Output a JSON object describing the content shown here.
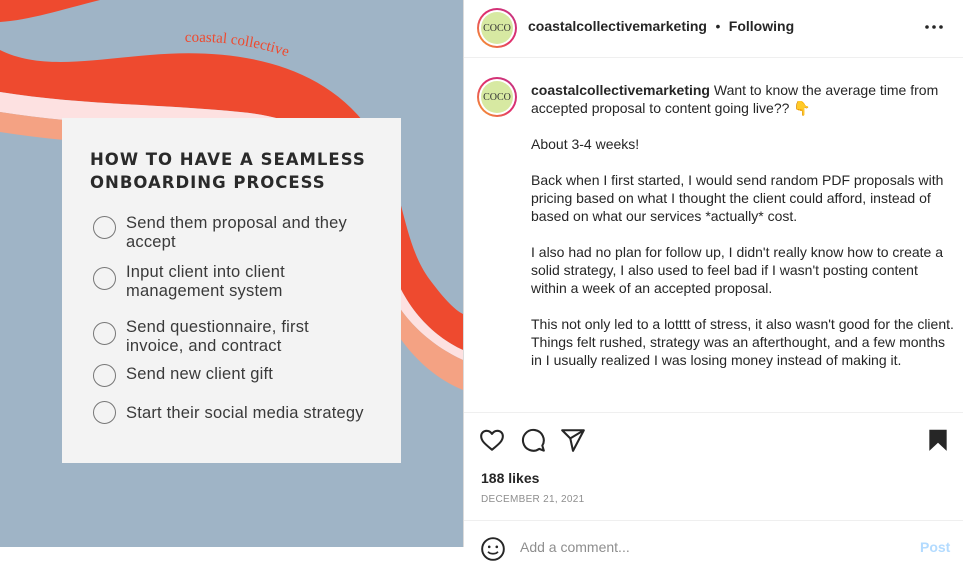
{
  "post_image": {
    "brand_arc_text": "coastal collective",
    "card_title_line1": "HOW TO HAVE A SEAMLESS",
    "card_title_line2": "ONBOARDING PROCESS",
    "checklist": [
      {
        "line1": "Send them proposal and they",
        "line2": "accept"
      },
      {
        "line1": "Input client into client",
        "line2": "management system"
      },
      {
        "line1": "Send questionnaire, first",
        "line2": "invoice, and contract"
      },
      {
        "line1": "Send new client gift",
        "line2": ""
      },
      {
        "line1": "Start their social media strategy",
        "line2": ""
      }
    ],
    "colors": {
      "background": "#9fb4c6",
      "wave_red": "#ee4a2f",
      "wave_pink": "#fde1e1",
      "wave_peach": "#f4a283",
      "card": "#f3f3f3"
    }
  },
  "header": {
    "avatar_text": "COCO",
    "username": "coastalcollectivemarketing",
    "separator": "•",
    "follow_status": "Following",
    "more_icon": "more-horizontal-icon"
  },
  "caption": {
    "avatar_text": "COCO",
    "username": "coastalcollectivemarketing",
    "intro": "Want to know the average time from accepted proposal to content going live?? 👇",
    "paragraphs": [
      "About 3-4 weeks!",
      "Back when I first started, I would send random PDF proposals with pricing based on what I thought the client could afford, instead of based on what our services *actually* cost.",
      "I also had no plan for follow up, I didn't really know how to create a solid strategy, I also used to feel bad if I wasn't posting content within a week of an accepted proposal.",
      "This not only led to a lotttt of stress, it also wasn't good for the client. Things felt rushed, strategy was an afterthought, and a few months in I usually realized I was losing money instead of making it."
    ]
  },
  "actions": {
    "icons": [
      "heart-icon",
      "comment-icon",
      "share-icon",
      "bookmark-icon"
    ],
    "likes": "188 likes",
    "date": "DECEMBER 21, 2021"
  },
  "comment": {
    "placeholder": "Add a comment...",
    "post_label": "Post",
    "emoji_icon": "emoji-icon"
  }
}
